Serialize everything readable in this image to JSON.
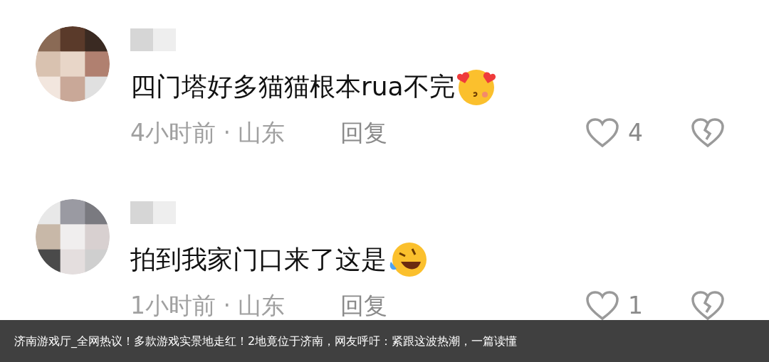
{
  "comments": [
    {
      "text": "四门塔好多猫猫根本rua不完",
      "kind": "heart-eyes",
      "time": "4小时前 · 山东",
      "reply": "回复",
      "likes": "4"
    },
    {
      "text": "拍到我家门口来了这是",
      "kind": "laughing",
      "time": "1小时前 · 山东",
      "reply": "回复",
      "likes": "1"
    }
  ],
  "caption": "济南游戏厅_全网热议！多款游戏实景地走红！2地竟位于济南，网友呼吁：紧跟这波热潮，一篇读懂"
}
